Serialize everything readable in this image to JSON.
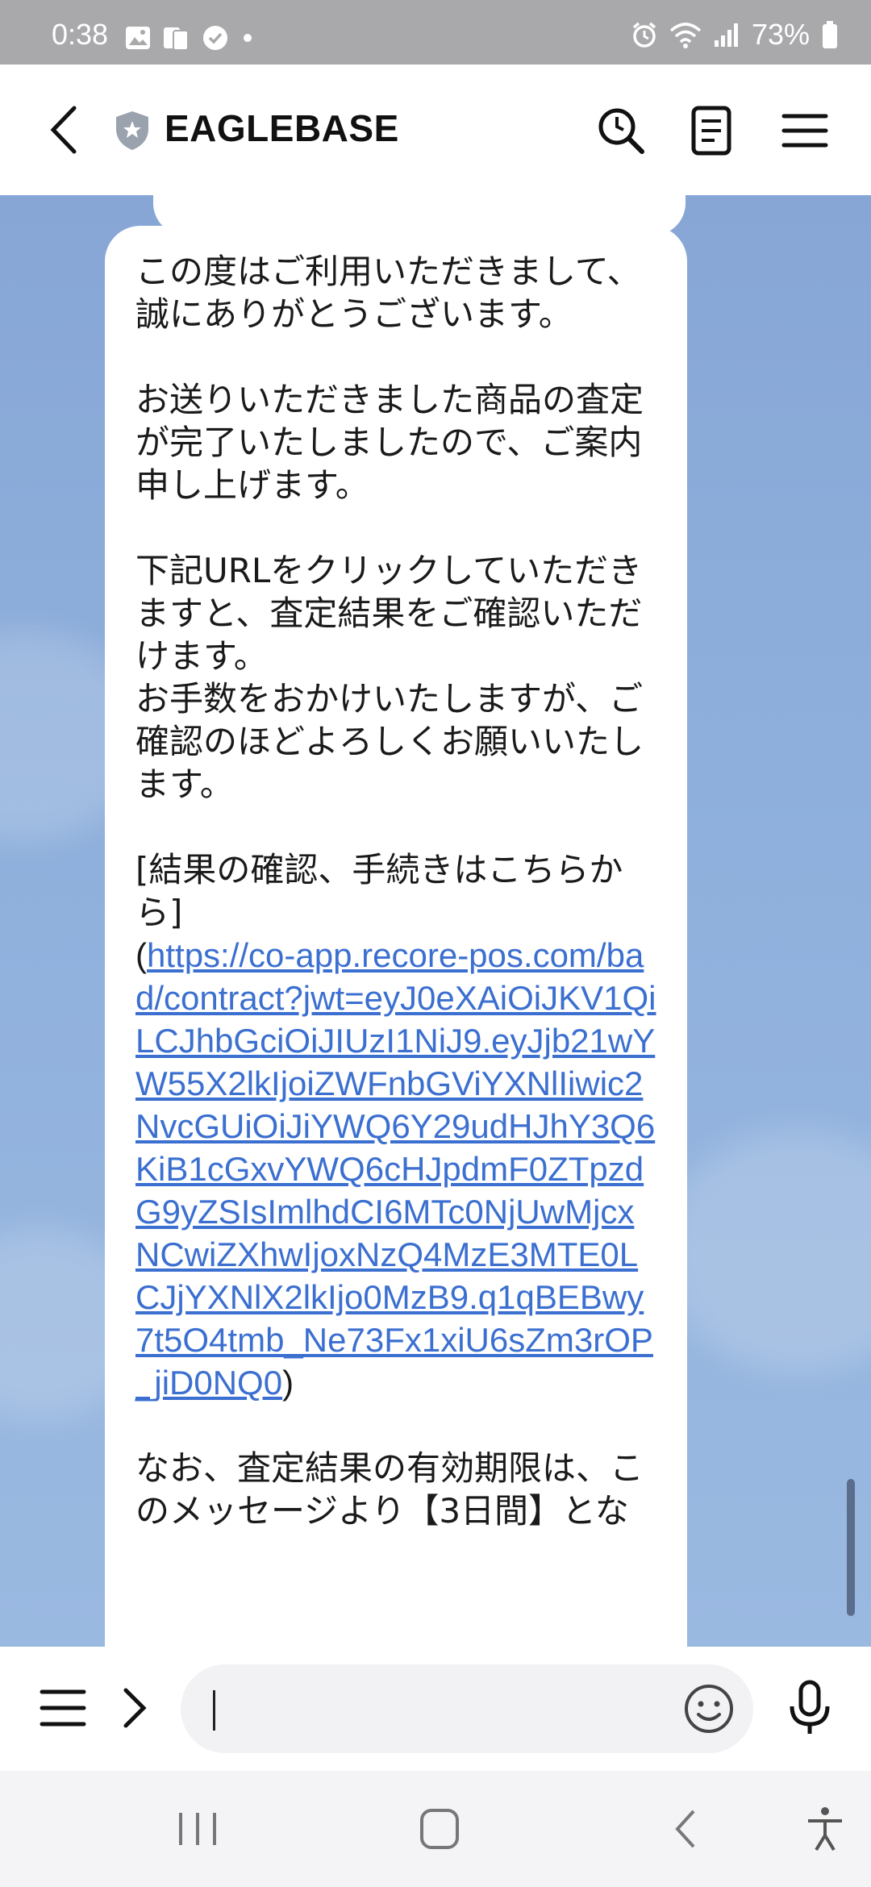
{
  "status_bar": {
    "time": "0:38",
    "battery": "73%"
  },
  "header": {
    "title": "EAGLEBASE"
  },
  "message": {
    "paragraphs": [
      "この度はご利用いただきまして、誠にありがとうございます。",
      "お送りいただきました商品の査定が完了いたしましたので、ご案内申し上げます。",
      "下記URLをクリックしていただきますと、査定結果をご確認いただけます。\nお手数をおかけいたしますが、ご確認のほどよろしくお願いいたします。",
      "[結果の確認、手続きはこちらから]"
    ],
    "link_open": "(",
    "link": "https://co-app.recore-pos.com/bad/contract?jwt=eyJ0eXAiOiJKV1QiLCJhbGciOiJIUzI1NiJ9.eyJjb21wYW55X2lkIjoiZWFnbGViYXNlIiwic2NvcGUiOiJiYWQ6Y29udHJhY3Q6KiB1cGxvYWQ6cHJpdmF0ZTpzdG9yZSIsImlhdCI6MTc0NjUwMjcxNCwiZXhwIjoxNzQ4MzE3MTE0LCJjYXNlX2lkIjo0MzB9.q1qBEBwy7t5O4tmb_Ne73Fx1xiU6sZm3rOP_jiD0NQ0",
    "link_close": ")",
    "footer": "なお、査定結果の有効期限は、このメッセージより【3日間】とな"
  },
  "input": {
    "placeholder": ""
  },
  "colors": {
    "header_bg": "#ffffff",
    "chat_bg": "#8eacd9",
    "link": "#3b6fd0",
    "status_bar": "#a9a9ab"
  }
}
